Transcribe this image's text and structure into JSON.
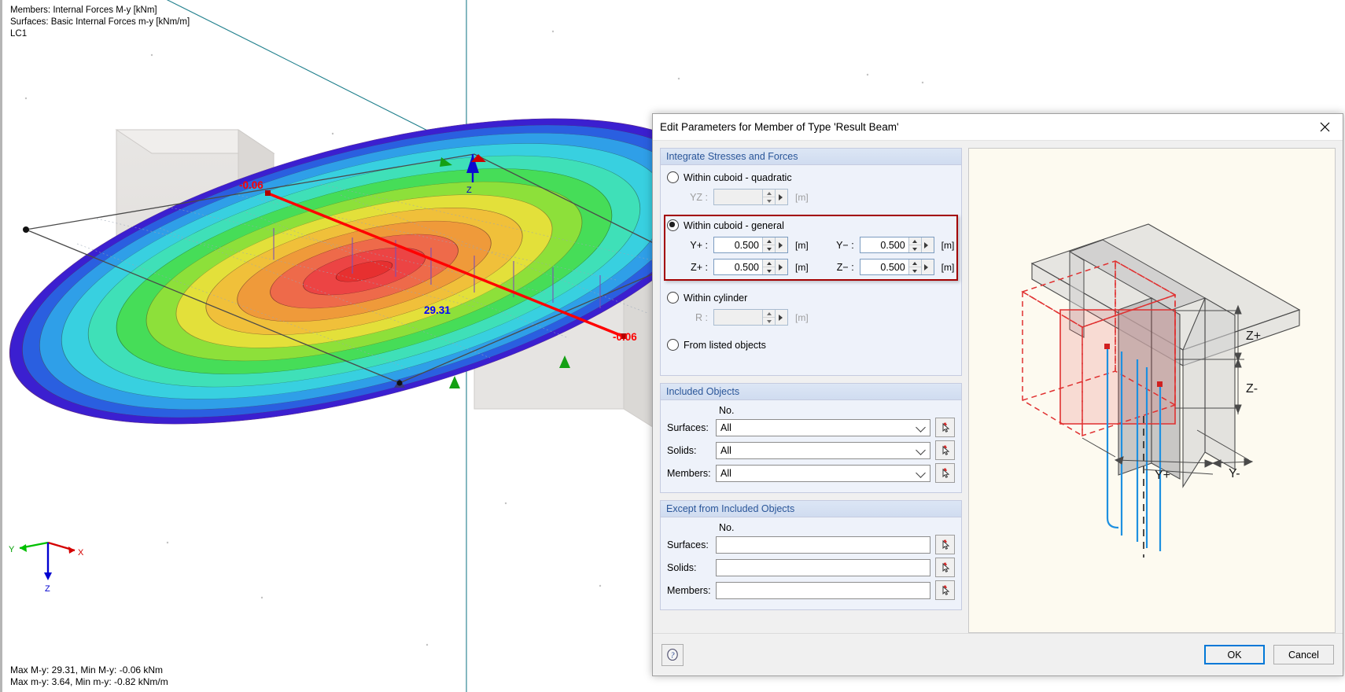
{
  "viewport": {
    "legend_lines": [
      "Members: Internal Forces M-y [kNm]",
      "Surfaces: Basic Internal Forces m-y [kNm/m]",
      "LC1"
    ],
    "status_lines": [
      "Max M-y: 29.31, Min M-y: -0.06 kNm",
      "Max m-y: 3.64, Min m-y: -0.82 kNm/m"
    ],
    "labels": {
      "min_left": "-0.06",
      "max_center": "29.31",
      "min_right": "-0.06",
      "node_z": "Z"
    },
    "axis": {
      "x": "X",
      "y": "Y",
      "z": "Z"
    },
    "colors": {
      "axis_x": "#d40000",
      "axis_y": "#00c000",
      "axis_z": "#0000d0",
      "member_line": "#ff0000",
      "max_label": "#0000ff",
      "min_label": "#ff0000",
      "grid_line": "#1f7f8c"
    }
  },
  "dialog": {
    "title": "Edit Parameters for Member of Type 'Result Beam'",
    "close_icon": "close-icon",
    "integrate": {
      "title": "Integrate Stresses and Forces",
      "options": [
        {
          "id": "cuboid-quadratic",
          "label": "Within cuboid - quadratic",
          "selected": false
        },
        {
          "id": "cuboid-general",
          "label": "Within cuboid - general",
          "selected": true
        },
        {
          "id": "cylinder",
          "label": "Within cylinder",
          "selected": false
        },
        {
          "id": "listed-objects",
          "label": "From listed objects",
          "selected": false
        }
      ],
      "quadratic_field": {
        "label": "YZ :",
        "value": "",
        "unit": "[m]",
        "enabled": false
      },
      "general_fields": [
        {
          "label": "Y+ :",
          "value": "0.500",
          "unit": "[m]"
        },
        {
          "label": "Y− :",
          "value": "0.500",
          "unit": "[m]"
        },
        {
          "label": "Z+ :",
          "value": "0.500",
          "unit": "[m]"
        },
        {
          "label": "Z− :",
          "value": "0.500",
          "unit": "[m]"
        }
      ],
      "cylinder_field": {
        "label": "R :",
        "value": "",
        "unit": "[m]",
        "enabled": false
      },
      "highlight_color": "#a30000"
    },
    "included": {
      "title": "Included Objects",
      "no_header": "No.",
      "rows": [
        {
          "label": "Surfaces:",
          "value": "All",
          "type": "combo",
          "pick_icon": "pick-objects-icon"
        },
        {
          "label": "Solids:",
          "value": "All",
          "type": "combo",
          "pick_icon": "pick-objects-icon"
        },
        {
          "label": "Members:",
          "value": "All",
          "type": "combo",
          "pick_icon": "pick-objects-icon"
        }
      ]
    },
    "excepted": {
      "title": "Except from Included Objects",
      "no_header": "No.",
      "rows": [
        {
          "label": "Surfaces:",
          "value": "",
          "type": "text",
          "pick_icon": "pick-objects-icon"
        },
        {
          "label": "Solids:",
          "value": "",
          "type": "text",
          "pick_icon": "pick-objects-icon"
        },
        {
          "label": "Members:",
          "value": "",
          "type": "text",
          "pick_icon": "pick-objects-icon"
        }
      ]
    },
    "preview": {
      "labels": {
        "z_plus": "Z+",
        "z_minus": "Z-",
        "y_plus": "Y+",
        "y_minus": "Y-"
      },
      "background": "#fdf8e7",
      "section_color": "#7f7f7f",
      "cuboid_color": "#e03030",
      "result_line_color": "#1e90e0"
    },
    "footer": {
      "help_icon": "help-icon",
      "ok_label": "OK",
      "cancel_label": "Cancel"
    }
  }
}
